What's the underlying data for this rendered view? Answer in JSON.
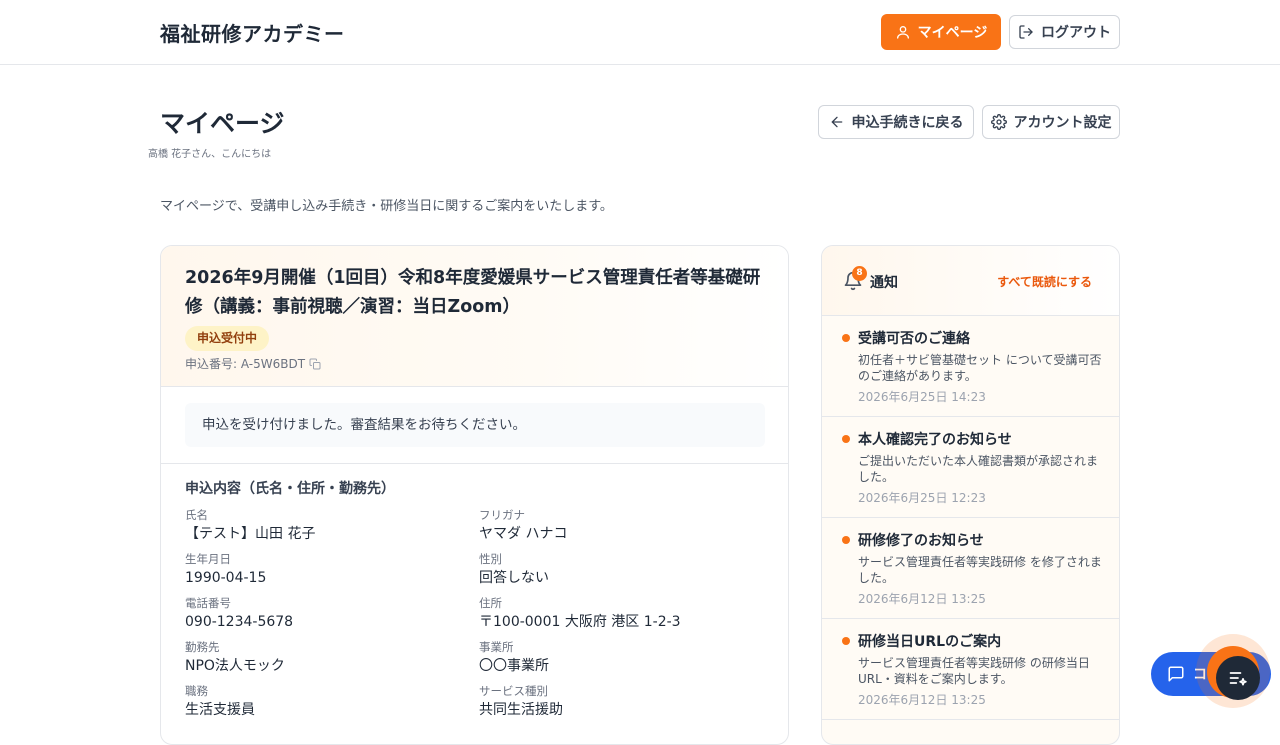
{
  "header": {
    "brand": "福祉研修アカデミー",
    "mypage_label": "マイページ",
    "logout_label": "ログアウト"
  },
  "page": {
    "title": "マイページ",
    "greeting": "高橋 花子さん、こんにちは",
    "back_label": "申込手続きに戻る",
    "account_label": "アカウント設定",
    "intro": "マイページで、受講申し込み手続き・研修当日に関するご案内をいたします。"
  },
  "application": {
    "title": "2026年9月開催（1回目）令和8年度愛媛県サービス管理責任者等基礎研修（講義：事前視聴／演習：当日Zoom）",
    "status": "申込受付中",
    "number_label": "申込番号: A-5W6BDT",
    "message": "申込を受け付けました。審査結果をお待ちください。",
    "section_title": "申込内容（氏名・住所・勤務先）",
    "fields": [
      {
        "label": "氏名",
        "value": "【テスト】山田 花子"
      },
      {
        "label": "フリガナ",
        "value": "ヤマダ ハナコ"
      },
      {
        "label": "生年月日",
        "value": "1990-04-15"
      },
      {
        "label": "性別",
        "value": "回答しない"
      },
      {
        "label": "電話番号",
        "value": "090-1234-5678"
      },
      {
        "label": "住所",
        "value": "〒100-0001 大阪府 港区 1-2-3"
      },
      {
        "label": "勤務先",
        "value": "NPO法人モック"
      },
      {
        "label": "事業所",
        "value": "〇〇事業所"
      },
      {
        "label": "職務",
        "value": "生活支援員"
      },
      {
        "label": "サービス種別",
        "value": "共同生活援助"
      }
    ]
  },
  "notifications": {
    "title": "通知",
    "count": "8",
    "mark_all_label": "すべて既読にする",
    "items": [
      {
        "title": "受講可否のご連絡",
        "body": "初任者＋サビ管基礎セット について受講可否のご連絡があります。",
        "date": "2026年6月25日 14:23"
      },
      {
        "title": "本人確認完了のお知らせ",
        "body": "ご提出いただいた本人確認書類が承認されました。",
        "date": "2026年6月25日 12:23"
      },
      {
        "title": "研修修了のお知らせ",
        "body": "サービス管理責任者等実践研修 を修了されました。",
        "date": "2026年6月12日 13:25"
      },
      {
        "title": "研修当日URLのご案内",
        "body": "サービス管理責任者等実践研修 の研修当日URL・資料をご案内します。",
        "date": "2026年6月12日 13:25"
      }
    ]
  },
  "chat": {
    "label": "コ"
  },
  "colors": {
    "accent": "#f97316",
    "chat": "#2563eb",
    "badge_bg": "#fef3c7"
  }
}
